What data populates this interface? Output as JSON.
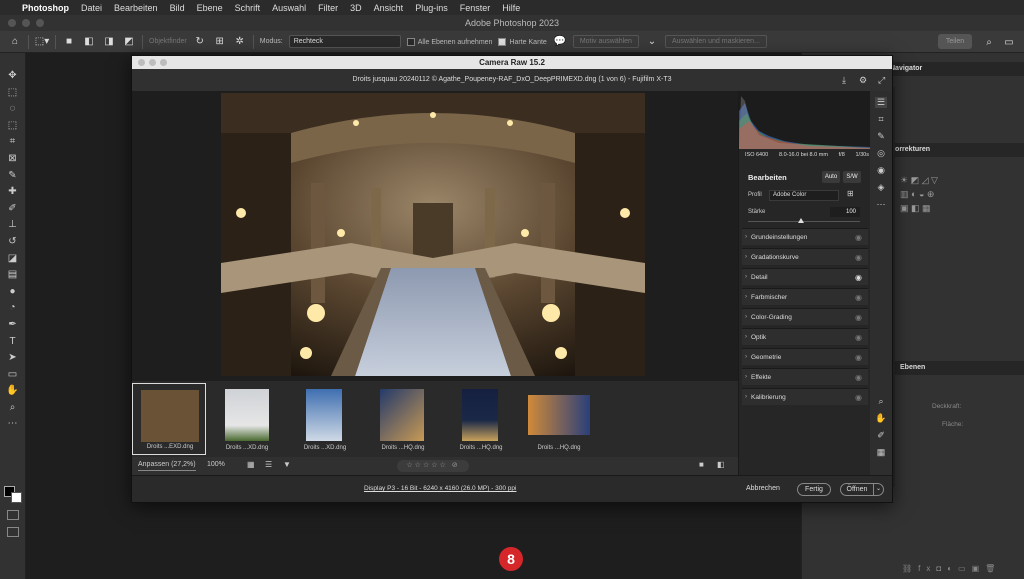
{
  "menubar": {
    "app": "Photoshop",
    "items": [
      "Datei",
      "Bearbeiten",
      "Bild",
      "Ebene",
      "Schrift",
      "Auswahl",
      "Filter",
      "3D",
      "Ansicht",
      "Plug-ins",
      "Fenster",
      "Hilfe"
    ]
  },
  "window_title": "Adobe Photoshop 2023",
  "options": {
    "objektfinder": "Objektfinder",
    "modus_label": "Modus:",
    "modus_value": "Rechteck",
    "alle_ebenen": "Alle Ebenen aufnehmen",
    "harte_kante": "Harte Kante",
    "motiv": "Motiv auswählen",
    "maskieren": "Auswählen und maskieren...",
    "teilen": "Teilen"
  },
  "panels": {
    "navigator": "Navigator",
    "korrekturen": "Korrekturen",
    "ebenen": "Ebenen",
    "deckkraft": "Deckkraft:",
    "flaeche": "Fläche:"
  },
  "camera_raw": {
    "title": "Camera Raw 15.2",
    "file": "Droits jusquau 20240112 © Agathe_Poupeney-RAF_DxO_DeepPRIMEXD.dng (1 von 6)  -  Fujifilm X-T3",
    "exif": {
      "iso": "ISO 6400",
      "lens": "8.0-16.0 bei 8.0 mm",
      "aperture": "f/8",
      "shutter": "1/30s"
    },
    "edit": {
      "heading": "Bearbeiten",
      "auto": "Auto",
      "sw": "S/W",
      "profil_label": "Profil",
      "profil_value": "Adobe Color",
      "staerke_label": "Stärke",
      "staerke_value": "100"
    },
    "sections": [
      "Grundeinstellungen",
      "Gradationskurve",
      "Detail",
      "Farbmischer",
      "Color-Grading",
      "Optik",
      "Geometrie",
      "Effekte",
      "Kalibrierung"
    ],
    "thumbs": [
      {
        "caption": "Droits ...EXD.dng"
      },
      {
        "caption": "Droits ...XD.dng"
      },
      {
        "caption": "Droits ...XD.dng"
      },
      {
        "caption": "Droits ...HQ.dng"
      },
      {
        "caption": "Droits ...HQ.dng"
      },
      {
        "caption": "Droits ...HQ.dng"
      }
    ],
    "zoom_fit": "Anpassen (27,2%)",
    "zoom_pct": "100%",
    "workflow": "Display P3 - 16 Bit - 6240 x 4160 (26.0 MP) - 300 ppi",
    "abbrechen": "Abbrechen",
    "fertig": "Fertig",
    "oeffnen": "Öffnen"
  },
  "step_badge": "8",
  "colors": {
    "accent_red": "#d5262a",
    "dialog_bg": "#252525"
  }
}
